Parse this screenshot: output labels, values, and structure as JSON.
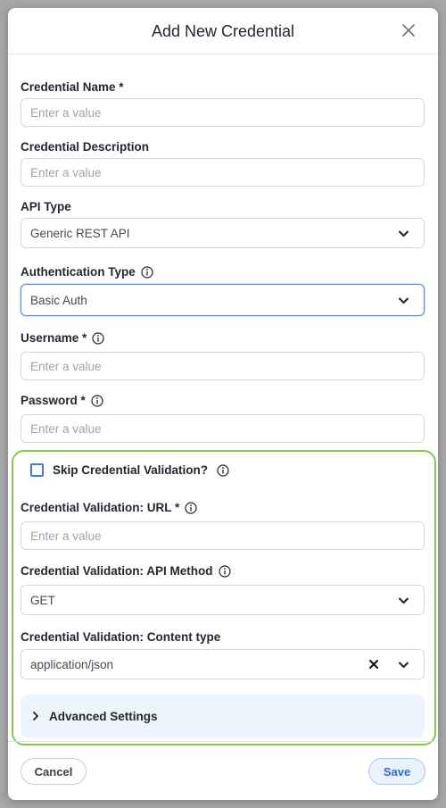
{
  "dialog": {
    "title": "Add New Credential"
  },
  "fields": {
    "credential_name": {
      "label": "Credential Name *",
      "placeholder": "Enter a value"
    },
    "credential_description": {
      "label": "Credential Description",
      "placeholder": "Enter a value"
    },
    "api_type": {
      "label": "API Type",
      "value": "Generic REST API"
    },
    "authentication_type": {
      "label": "Authentication Type",
      "value": "Basic Auth"
    },
    "username": {
      "label": "Username *",
      "placeholder": "Enter a value"
    },
    "password": {
      "label": "Password *",
      "placeholder": "Enter a value"
    }
  },
  "validation": {
    "skip_label": "Skip Credential Validation?",
    "skip_checked": false,
    "url": {
      "label": "Credential Validation: URL *",
      "placeholder": "Enter a value"
    },
    "api_method": {
      "label": "Credential Validation: API Method",
      "value": "GET"
    },
    "content_type": {
      "label": "Credential Validation: Content type",
      "value": "application/json"
    },
    "advanced_label": "Advanced Settings"
  },
  "footer": {
    "cancel_label": "Cancel",
    "save_label": "Save"
  },
  "colors": {
    "accent": "#3f76e0",
    "validation_border": "#8ac64a",
    "focused_border": "#5b8be8"
  },
  "icons": [
    "close-icon",
    "info-icon",
    "chevron-down-icon",
    "clear-icon",
    "chevron-right-icon"
  ]
}
